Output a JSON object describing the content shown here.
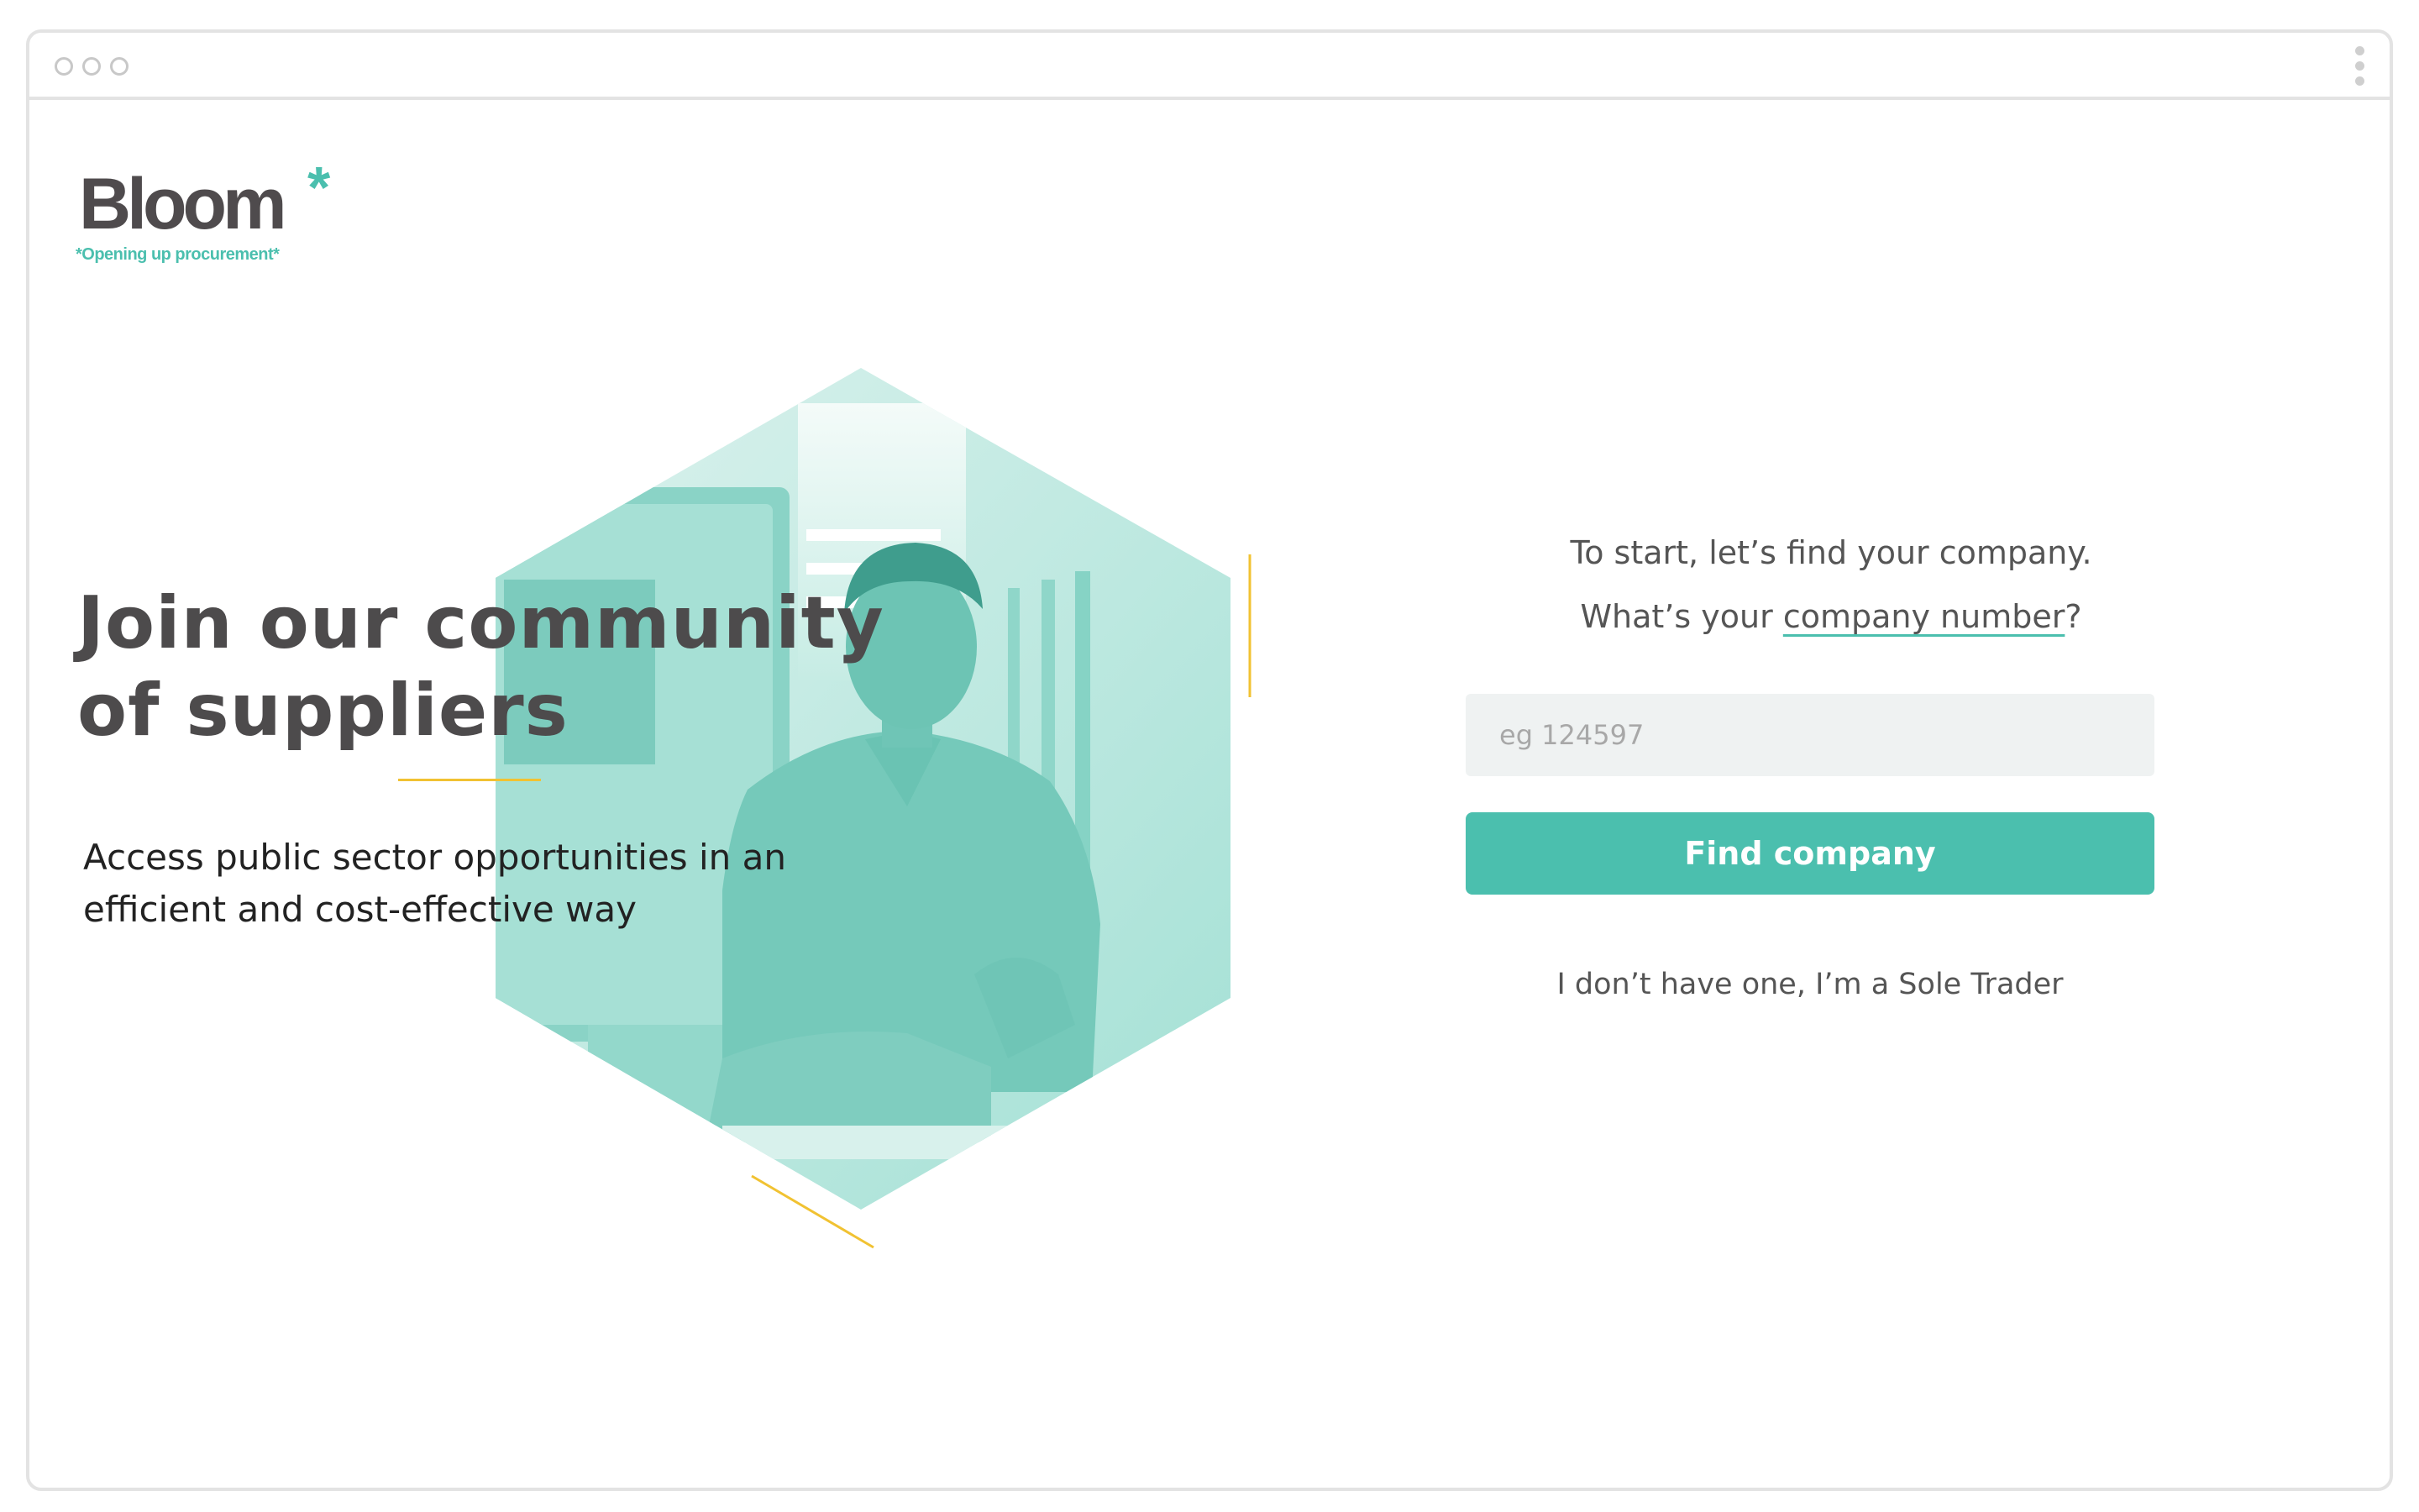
{
  "logo": {
    "word": "Bloom",
    "star": "*",
    "tagline": "*Opening up procurement*"
  },
  "hero": {
    "title_line1": "Join our community",
    "title_line2": "of suppliers",
    "subtitle_line1": "Access public sector opportunities in an",
    "subtitle_line2": "efficient and cost-effective way",
    "image": "hexagon-photo-person-working"
  },
  "form": {
    "intro_line1": "To start, let’s find your company.",
    "intro_prefix": "What’s your ",
    "intro_link": "company number",
    "intro_suffix": "?",
    "input_placeholder": "eg 124597",
    "submit_label": "Find company",
    "sole_trader_link": "I don’t have one, I’m a Sole Trader"
  },
  "colors": {
    "brand": "#4bbfae",
    "accent": "#f1c232",
    "text_dark": "#4d4b4c"
  }
}
